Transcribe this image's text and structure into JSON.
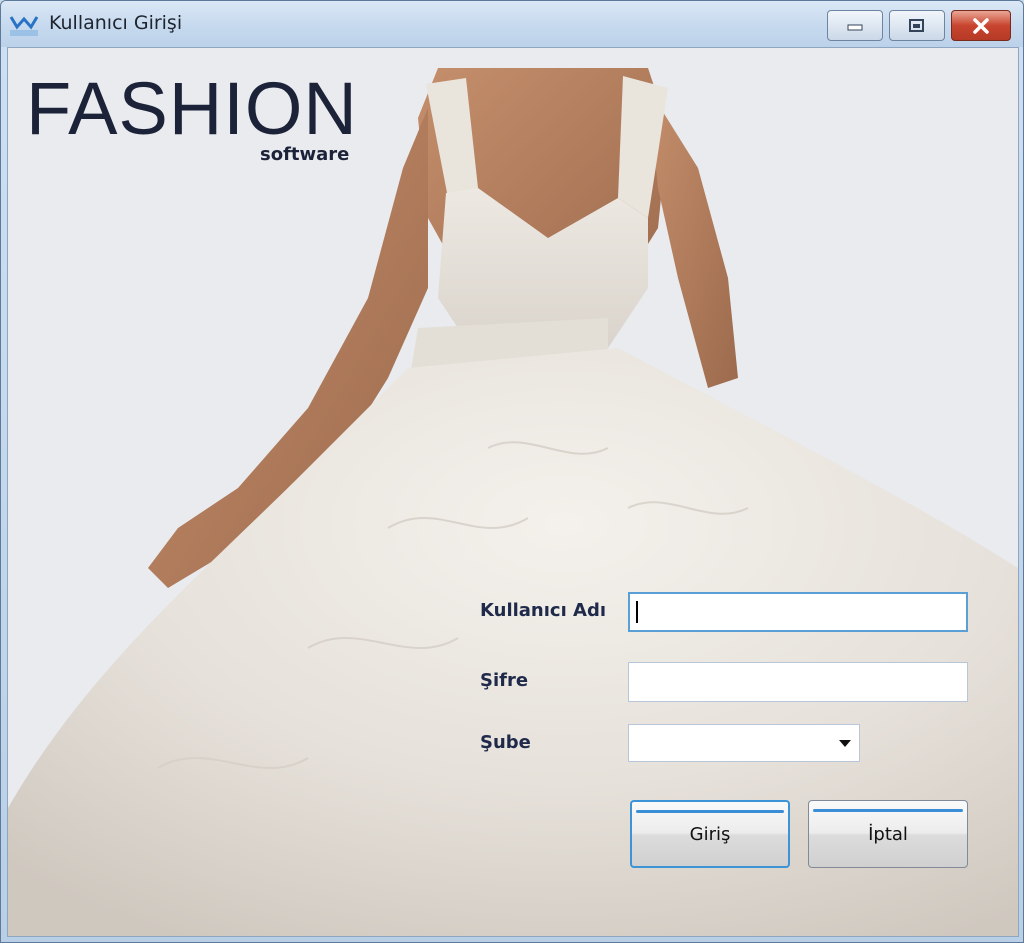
{
  "window": {
    "title": "Kullanıcı Girişi",
    "icon": "vanko-logo-icon",
    "controls": [
      "minimize-icon",
      "maximize-icon",
      "close-icon"
    ]
  },
  "branding": {
    "main": "FASHION",
    "sub": "software"
  },
  "form": {
    "username_label": "Kullanıcı Adı",
    "username_value": "",
    "password_label": "Şifre",
    "password_value": "",
    "branch_label": "Şube",
    "branch_value": ""
  },
  "buttons": {
    "login": "Giriş",
    "cancel": "İptal"
  },
  "colors": {
    "accent": "#3c93d6",
    "label": "#1f2a4a",
    "close": "#c8452f"
  }
}
